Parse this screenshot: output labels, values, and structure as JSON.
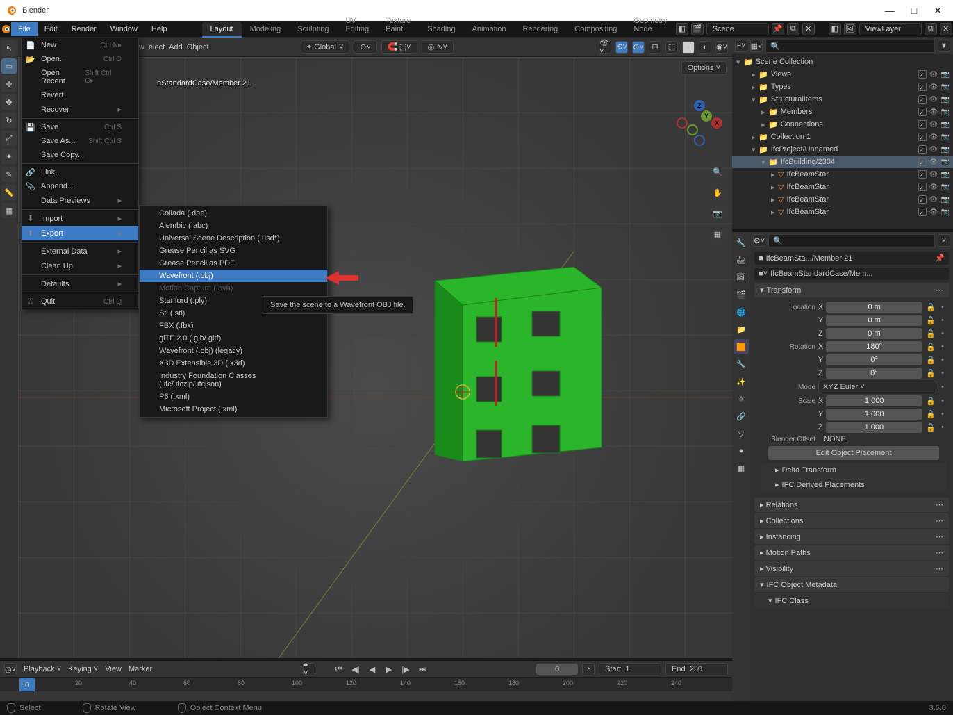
{
  "window": {
    "title": "Blender"
  },
  "menubar": {
    "items": [
      "File",
      "Edit",
      "Render",
      "Window",
      "Help"
    ],
    "active": "File"
  },
  "workspace_tabs": [
    "Layout",
    "Modeling",
    "Sculpting",
    "UV Editing",
    "Texture Paint",
    "Shading",
    "Animation",
    "Rendering",
    "Compositing",
    "Geometry Node"
  ],
  "scene_field": "Scene",
  "viewlayer_field": "ViewLayer",
  "viewport_header": {
    "select_label": "elect",
    "add_label": "Add",
    "object_label": "Object",
    "orientation": "Global",
    "options_label": "Options"
  },
  "viewport_info": "nStandardCase/Member 21",
  "file_menu": [
    {
      "label": "New",
      "shortcut": "Ctrl N",
      "sub": true,
      "icon": "doc"
    },
    {
      "label": "Open...",
      "shortcut": "Ctrl O",
      "icon": "folder"
    },
    {
      "label": "Open Recent",
      "shortcut": "Shift Ctrl O",
      "sub": true
    },
    {
      "label": "Revert"
    },
    {
      "label": "Recover",
      "sub": true
    },
    {
      "sep": true
    },
    {
      "label": "Save",
      "shortcut": "Ctrl S",
      "icon": "save"
    },
    {
      "label": "Save As...",
      "shortcut": "Shift Ctrl S"
    },
    {
      "label": "Save Copy..."
    },
    {
      "sep": true
    },
    {
      "label": "Link...",
      "icon": "link"
    },
    {
      "label": "Append...",
      "icon": "clip"
    },
    {
      "label": "Data Previews",
      "sub": true
    },
    {
      "sep": true
    },
    {
      "label": "Import",
      "sub": true,
      "icon": "import"
    },
    {
      "label": "Export",
      "sub": true,
      "highlighted": true,
      "icon": "export"
    },
    {
      "sep": true
    },
    {
      "label": "External Data",
      "sub": true
    },
    {
      "label": "Clean Up",
      "sub": true
    },
    {
      "sep": true
    },
    {
      "label": "Defaults",
      "sub": true
    },
    {
      "sep": true
    },
    {
      "label": "Quit",
      "shortcut": "Ctrl Q",
      "icon": "power"
    }
  ],
  "export_submenu": [
    {
      "label": "Collada (.dae)"
    },
    {
      "label": "Alembic (.abc)"
    },
    {
      "label": "Universal Scene Description (.usd*)"
    },
    {
      "label": "Grease Pencil as SVG"
    },
    {
      "label": "Grease Pencil as PDF"
    },
    {
      "label": "Wavefront (.obj)",
      "highlighted": true
    },
    {
      "label": "Motion Capture (.bvh)",
      "disabled": true
    },
    {
      "label": "Stanford (.ply)"
    },
    {
      "label": "Stl (.stl)"
    },
    {
      "label": "FBX (.fbx)"
    },
    {
      "label": "glTF 2.0 (.glb/.gltf)"
    },
    {
      "label": "Wavefront (.obj) (legacy)"
    },
    {
      "label": "X3D Extensible 3D (.x3d)"
    },
    {
      "label": "Industry Foundation Classes (.ifc/.ifczip/.ifcjson)"
    },
    {
      "label": "P6 (.xml)"
    },
    {
      "label": "Microsoft Project (.xml)"
    }
  ],
  "tooltip": "Save the scene to a Wavefront OBJ file.",
  "outliner": {
    "root": "Scene Collection",
    "items": [
      {
        "indent": 1,
        "name": "Views",
        "icon": "col"
      },
      {
        "indent": 1,
        "name": "Types",
        "icon": "col"
      },
      {
        "indent": 1,
        "name": "StructuralItems",
        "icon": "col",
        "expanded": true
      },
      {
        "indent": 2,
        "name": "Members",
        "icon": "col"
      },
      {
        "indent": 2,
        "name": "Connections",
        "icon": "col"
      },
      {
        "indent": 1,
        "name": "Collection 1",
        "icon": "col"
      },
      {
        "indent": 1,
        "name": "IfcProject/Unnamed",
        "icon": "col",
        "expanded": true
      },
      {
        "indent": 2,
        "name": "IfcBuilding/2304",
        "icon": "col",
        "expanded": true,
        "selected": true
      },
      {
        "indent": 3,
        "name": "IfcBeamStar",
        "icon": "obj"
      },
      {
        "indent": 3,
        "name": "IfcBeamStar",
        "icon": "obj"
      },
      {
        "indent": 3,
        "name": "IfcBeamStar",
        "icon": "obj"
      },
      {
        "indent": 3,
        "name": "IfcBeamStar",
        "icon": "obj"
      }
    ]
  },
  "properties": {
    "breadcrumb1": "IfcBeamSta.../Member 21",
    "breadcrumb2": "IfcBeamStandardCase/Mem...",
    "transform_label": "Transform",
    "location": {
      "label": "Location",
      "x": "0 m",
      "y": "0 m",
      "z": "0 m"
    },
    "rotation": {
      "label": "Rotation",
      "x": "180°",
      "y": "0°",
      "z": "0°"
    },
    "mode_label": "Mode",
    "mode_value": "XYZ Euler",
    "scale": {
      "label": "Scale",
      "x": "1.000",
      "y": "1.000",
      "z": "1.000"
    },
    "blender_offset_label": "Blender Offset",
    "blender_offset_value": "NONE",
    "edit_placement": "Edit Object Placement",
    "delta_transform": "Delta Transform",
    "ifc_derived": "IFC Derived Placements",
    "panels": [
      "Relations",
      "Collections",
      "Instancing",
      "Motion Paths",
      "Visibility",
      "IFC Object Metadata"
    ],
    "ifc_class": "IFC Class"
  },
  "timeline": {
    "playback": "Playback",
    "keying": "Keying",
    "view": "View",
    "marker": "Marker",
    "frame": "0",
    "start_label": "Start",
    "start": "1",
    "end_label": "End",
    "end": "250",
    "ticks": [
      "0",
      "20",
      "40",
      "60",
      "80",
      "100",
      "120",
      "140",
      "160",
      "180",
      "200",
      "220",
      "240"
    ]
  },
  "status": {
    "select": "Select",
    "rotate": "Rotate View",
    "context": "Object Context Menu",
    "version": "3.5.0"
  }
}
